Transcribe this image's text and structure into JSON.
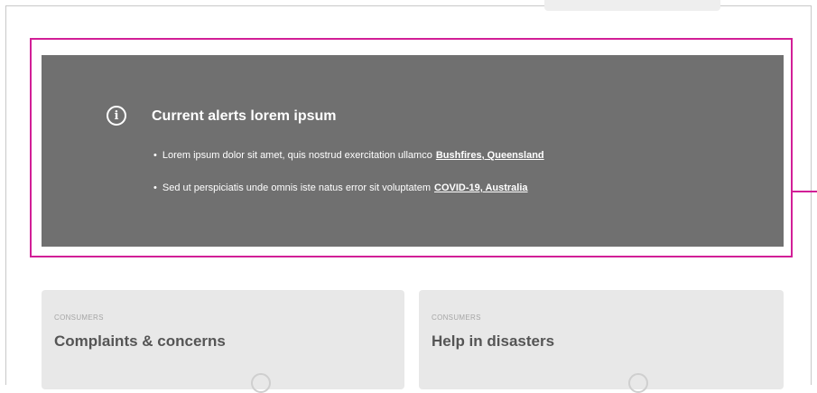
{
  "alert": {
    "title": "Current alerts lorem ipsum",
    "icon": "info-icon",
    "items": [
      {
        "text": "Lorem ipsum dolor sit amet, quis nostrud exercitation ullamco",
        "link": "Bushfires, Queensland"
      },
      {
        "text": "Sed ut perspiciatis unde omnis iste natus error sit voluptatem",
        "link": "COVID-19, Australia"
      }
    ]
  },
  "cards": [
    {
      "eyebrow": "CONSUMERS",
      "title": "Complaints & concerns"
    },
    {
      "eyebrow": "CONSUMERS",
      "title": "Help in disasters"
    }
  ],
  "colors": {
    "highlight": "#d21f97",
    "alert_background": "#707070",
    "card_background": "#e8e8e8"
  }
}
